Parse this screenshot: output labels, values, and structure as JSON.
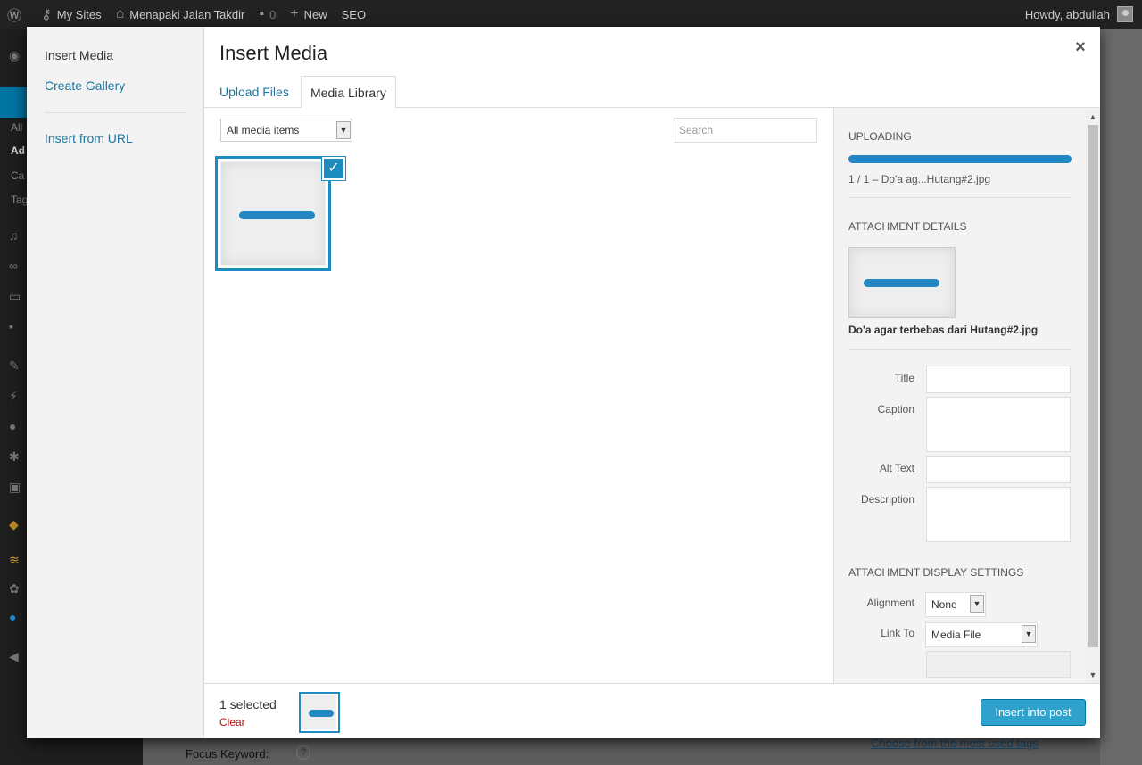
{
  "adminbar": {
    "my_sites": "My Sites",
    "site_name": "Menapaki Jalan Takdir",
    "comments_count": "0",
    "new_label": "New",
    "seo_label": "SEO",
    "howdy": "Howdy, abdullah"
  },
  "backdrop": {
    "menu_items": [
      "All",
      "Ad",
      "Ca",
      "Tag"
    ],
    "focus_keyword": "Focus Keyword:",
    "choose_tags_link": "Choose from the most used tags"
  },
  "modal": {
    "menu": {
      "insert_media": "Insert Media",
      "create_gallery": "Create Gallery",
      "insert_from_url": "Insert from URL"
    },
    "title": "Insert Media",
    "close_label": "×",
    "tabs": [
      "Upload Files",
      "Media Library"
    ],
    "filter": {
      "selected": "All media items"
    },
    "search": {
      "placeholder": "Search"
    },
    "sidebar": {
      "uploading_heading": "Uploading",
      "upload_info": "1 / 1  –  Do'a ag...Hutang#2.jpg",
      "upload_progress": 1.0,
      "attachment_heading": "Attachment Details",
      "filename": "Do'a agar terbebas dari Hutang#2.jpg",
      "fields": {
        "title_label": "Title",
        "caption_label": "Caption",
        "alt_label": "Alt Text",
        "description_label": "Description"
      },
      "display_heading": "Attachment Display Settings",
      "alignment_label": "Alignment",
      "alignment_value": "None",
      "link_to_label": "Link To",
      "link_to_value": "Media File"
    },
    "toolbar": {
      "selected_count": "1 selected",
      "clear_label": "Clear",
      "insert_button": "Insert into post"
    }
  },
  "colors": {
    "accent": "#1e8cbe",
    "button": "#2ea2cc",
    "link": "#21759b",
    "danger": "#bc0b0b"
  }
}
